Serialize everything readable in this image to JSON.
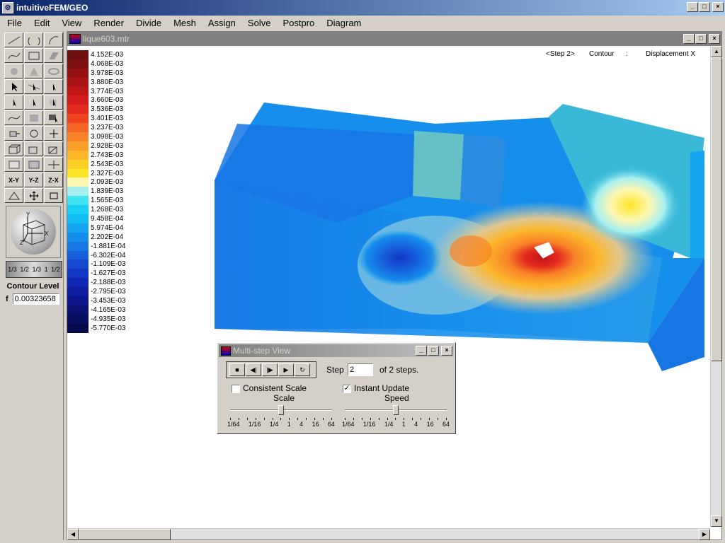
{
  "app": {
    "title": "intuitiveFEM/GEO",
    "window_buttons": [
      "_",
      "□",
      "×"
    ]
  },
  "menu": [
    "File",
    "Edit",
    "View",
    "Render",
    "Divide",
    "Mesh",
    "Assign",
    "Solve",
    "Postpro",
    "Diagram"
  ],
  "toolbox": {
    "axis_buttons": [
      "X-Y",
      "Y-Z",
      "Z-X"
    ],
    "scale_strip": [
      "1/3",
      "1/2",
      "1/3",
      "1",
      "1/2"
    ],
    "contour_label": "Contour Level",
    "contour_f": "f",
    "contour_value": "0.00323658"
  },
  "document": {
    "title": "lique603.mtr",
    "info_step": "<Step 2>",
    "info_type": "Contour",
    "info_sep": ":",
    "info_field": "Displacement X"
  },
  "legend": {
    "entries": [
      {
        "label": "4.152E-03",
        "color": "#6b0f0f"
      },
      {
        "label": "4.068E-03",
        "color": "#7e1010"
      },
      {
        "label": "3.978E-03",
        "color": "#941212"
      },
      {
        "label": "3.880E-03",
        "color": "#aa1414"
      },
      {
        "label": "3.774E-03",
        "color": "#c01616"
      },
      {
        "label": "3.660E-03",
        "color": "#d41c1c"
      },
      {
        "label": "3.536E-03",
        "color": "#e42a1e"
      },
      {
        "label": "3.401E-03",
        "color": "#f04420"
      },
      {
        "label": "3.237E-03",
        "color": "#f46424"
      },
      {
        "label": "3.098E-03",
        "color": "#f88428"
      },
      {
        "label": "2.928E-03",
        "color": "#fa9e2a"
      },
      {
        "label": "2.743E-03",
        "color": "#fcb62a"
      },
      {
        "label": "2.543E-03",
        "color": "#fdd028"
      },
      {
        "label": "2.327E-03",
        "color": "#fde626"
      },
      {
        "label": "2.093E-03",
        "color": "#fdf7b0"
      },
      {
        "label": "1.839E-03",
        "color": "#a8f0f0"
      },
      {
        "label": "1.565E-03",
        "color": "#40e4f0"
      },
      {
        "label": "1.268E-03",
        "color": "#18d0f4"
      },
      {
        "label": "9.458E-04",
        "color": "#12bcf4"
      },
      {
        "label": "5.974E-04",
        "color": "#14a4f0"
      },
      {
        "label": "2.202E-04",
        "color": "#168eec"
      },
      {
        "label": "-1.881E-04",
        "color": "#1676e4"
      },
      {
        "label": "-6.302E-04",
        "color": "#165edc"
      },
      {
        "label": "-1.109E-03",
        "color": "#1448d0"
      },
      {
        "label": "-1.627E-03",
        "color": "#1236c4"
      },
      {
        "label": "-2.188E-03",
        "color": "#1026b4"
      },
      {
        "label": "-2.795E-03",
        "color": "#0e1ca0"
      },
      {
        "label": "-3.453E-03",
        "color": "#0c168a"
      },
      {
        "label": "-4.165E-03",
        "color": "#0a1274"
      },
      {
        "label": "-4.935E-03",
        "color": "#080e60"
      },
      {
        "label": "-5.770E-03",
        "color": "#060a4c"
      }
    ]
  },
  "dialog": {
    "title": "Multi-step View",
    "step_label": "Step",
    "step_value": "2",
    "of_steps": "of 2 steps.",
    "consistent_scale": "Consistent Scale",
    "instant_update": "Instant Update",
    "instant_update_checked": true,
    "consistent_scale_checked": false,
    "scale_label": "Scale",
    "speed_label": "Speed",
    "scale_ticks": [
      "1/64",
      "1/16",
      "1/4",
      "1",
      "4",
      "16",
      "64"
    ],
    "speed_ticks": [
      "1/64",
      "1/16",
      "1/4",
      "1",
      "4",
      "16",
      "64"
    ],
    "scale_value": "1",
    "speed_value": "1"
  }
}
